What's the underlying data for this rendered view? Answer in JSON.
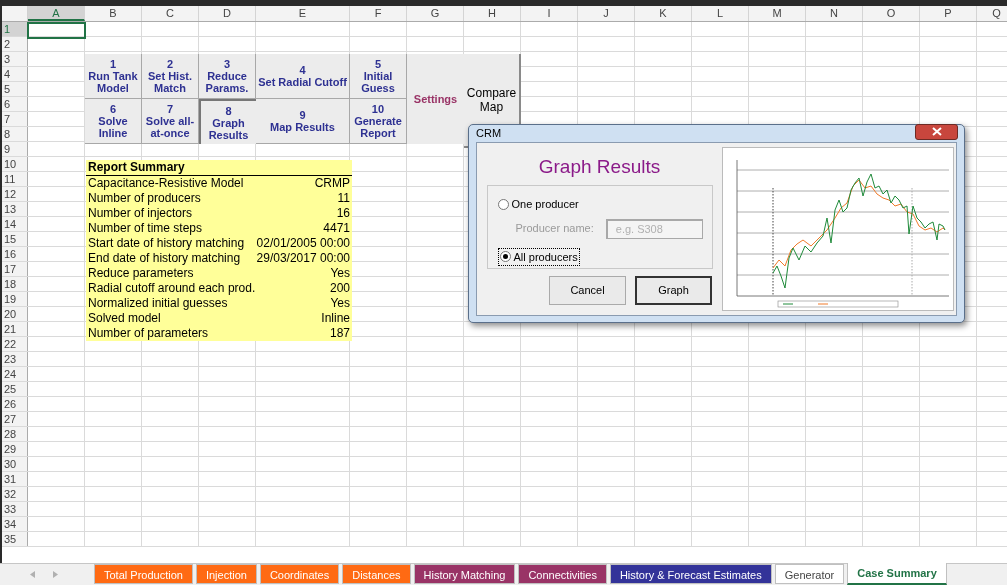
{
  "columns": [
    {
      "label": "A",
      "selected": true
    },
    {
      "label": "B",
      "selected": false
    },
    {
      "label": "C",
      "selected": false
    },
    {
      "label": "D",
      "selected": false
    },
    {
      "label": "E",
      "selected": false
    },
    {
      "label": "F",
      "selected": false
    },
    {
      "label": "G",
      "selected": false
    },
    {
      "label": "H",
      "selected": false
    },
    {
      "label": "I",
      "selected": false
    },
    {
      "label": "J",
      "selected": false
    },
    {
      "label": "K",
      "selected": false
    },
    {
      "label": "L",
      "selected": false
    },
    {
      "label": "M",
      "selected": false
    },
    {
      "label": "N",
      "selected": false
    },
    {
      "label": "O",
      "selected": false
    },
    {
      "label": "P",
      "selected": false
    },
    {
      "label": "Q",
      "selected": false
    }
  ],
  "rows": [
    {
      "label": "1",
      "selected": true
    },
    {
      "label": "2",
      "selected": false
    },
    {
      "label": "3",
      "selected": false
    },
    {
      "label": "4",
      "selected": false
    },
    {
      "label": "5",
      "selected": false
    },
    {
      "label": "6",
      "selected": false
    },
    {
      "label": "7",
      "selected": false
    },
    {
      "label": "8",
      "selected": false
    },
    {
      "label": "9",
      "selected": false
    },
    {
      "label": "10",
      "selected": false
    },
    {
      "label": "11",
      "selected": false
    },
    {
      "label": "12",
      "selected": false
    },
    {
      "label": "13",
      "selected": false
    },
    {
      "label": "14",
      "selected": false
    },
    {
      "label": "15",
      "selected": false
    },
    {
      "label": "16",
      "selected": false
    },
    {
      "label": "17",
      "selected": false
    },
    {
      "label": "18",
      "selected": false
    },
    {
      "label": "19",
      "selected": false
    },
    {
      "label": "20",
      "selected": false
    },
    {
      "label": "21",
      "selected": false
    },
    {
      "label": "22",
      "selected": false
    },
    {
      "label": "23",
      "selected": false
    },
    {
      "label": "24",
      "selected": false
    },
    {
      "label": "25",
      "selected": false
    },
    {
      "label": "26",
      "selected": false
    },
    {
      "label": "27",
      "selected": false
    },
    {
      "label": "28",
      "selected": false
    },
    {
      "label": "29",
      "selected": false
    },
    {
      "label": "30",
      "selected": false
    },
    {
      "label": "31",
      "selected": false
    },
    {
      "label": "32",
      "selected": false
    },
    {
      "label": "33",
      "selected": false
    },
    {
      "label": "34",
      "selected": false
    },
    {
      "label": "35",
      "selected": false
    }
  ],
  "sheet_buttons": [
    {
      "kind": "macro",
      "label": "1\nRun Tank\nModel",
      "pressed": false
    },
    {
      "kind": "macro",
      "label": "2\nSet Hist.\nMatch",
      "pressed": false
    },
    {
      "kind": "macro",
      "label": "3\nReduce\nParams.",
      "pressed": false
    },
    {
      "kind": "macro",
      "label": "4\nSet Radial Cutoff",
      "pressed": false
    },
    {
      "kind": "macro",
      "label": "5\nInitial\nGuess",
      "pressed": false
    },
    {
      "kind": "macro",
      "label": "6\nSolve\nInline",
      "pressed": false
    },
    {
      "kind": "macro",
      "label": "7\nSolve all-\nat-once",
      "pressed": false
    },
    {
      "kind": "macro",
      "label": "8\nGraph\nResults",
      "pressed": true
    },
    {
      "kind": "macro",
      "label": "9\nMap Results",
      "pressed": false
    },
    {
      "kind": "macro",
      "label": "10\nGenerate\nReport",
      "pressed": false
    },
    {
      "kind": "settings",
      "label": "Settings"
    },
    {
      "kind": "map",
      "label": "Compare\nMap"
    }
  ],
  "report_summary": {
    "title": "Report Summary",
    "rows": [
      {
        "label": "Capacitance-Resistive Model",
        "value": "CRMP"
      },
      {
        "label": "Number of producers",
        "value": "11"
      },
      {
        "label": "Number of injectors",
        "value": "16"
      },
      {
        "label": "Number of time steps",
        "value": "4471"
      },
      {
        "label": "Start date of history matching",
        "value": "02/01/2005 00:00"
      },
      {
        "label": "End date of history matching",
        "value": "29/03/2017 00:00"
      },
      {
        "label": "Reduce parameters",
        "value": "Yes"
      },
      {
        "label": "Radial cutoff around each prod.",
        "value": "200"
      },
      {
        "label": "Normalized initial guesses",
        "value": "Yes"
      },
      {
        "label": "Solved model",
        "value": "Inline"
      },
      {
        "label": "Number of parameters",
        "value": "187"
      }
    ]
  },
  "dialog": {
    "title": "CRM",
    "heading": "Graph Results",
    "options": [
      {
        "label": "One producer",
        "selected": false
      },
      {
        "label": "All producers",
        "selected": true
      }
    ],
    "producer_field": {
      "label": "Producer name:",
      "placeholder": "e.g. S308",
      "disabled": true
    },
    "buttons": [
      {
        "label": "Cancel",
        "default": false
      },
      {
        "label": "Graph",
        "default": true
      }
    ]
  },
  "sheet_tabs": [
    {
      "label": "Total Production",
      "color": "#ff6a13",
      "selected": false
    },
    {
      "label": "Injection",
      "color": "#ff6a13",
      "selected": false
    },
    {
      "label": "Coordinates",
      "color": "#ff6a13",
      "selected": false
    },
    {
      "label": "Distances",
      "color": "#ff6a13",
      "selected": false
    },
    {
      "label": "History Matching",
      "color": "#993366",
      "selected": false
    },
    {
      "label": "Connectivities",
      "color": "#993366",
      "selected": false
    },
    {
      "label": "History & Forecast Estimates",
      "color": "#333399",
      "selected": false
    },
    {
      "label": "Generator",
      "color": "#ffffff",
      "selected": false
    },
    {
      "label": "Case Summary",
      "color": "#ffffff",
      "selected": true
    }
  ]
}
